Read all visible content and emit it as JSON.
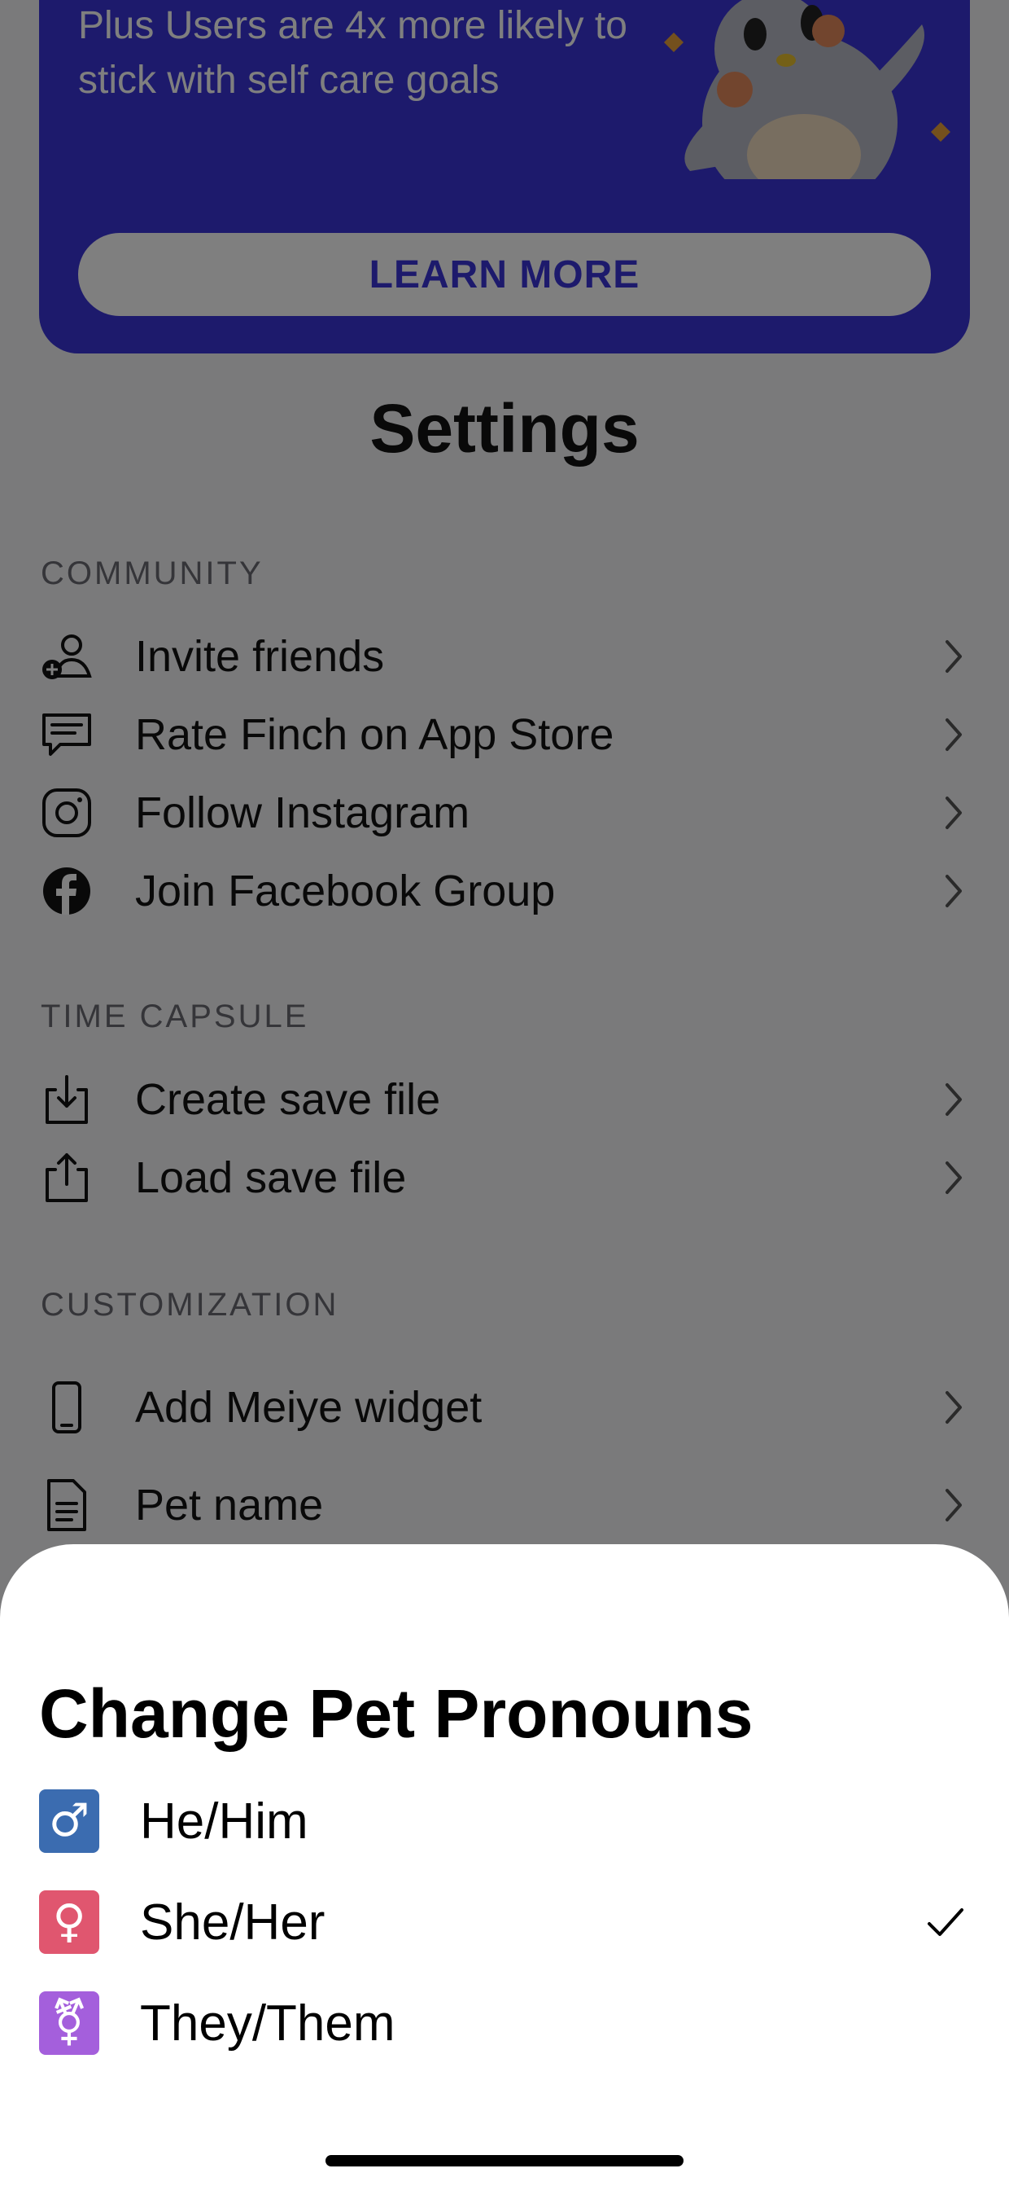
{
  "promo": {
    "text": "Plus Users are 4x more likely to stick with self care goals",
    "button_label": "LEARN MORE",
    "accent": "#3a34d8"
  },
  "settings_title": "Settings",
  "sections": {
    "community": {
      "header": "COMMUNITY",
      "items": [
        {
          "label": "Invite friends",
          "icon": "add-person-icon"
        },
        {
          "label": "Rate Finch on App Store",
          "icon": "chat-icon"
        },
        {
          "label": "Follow Instagram",
          "icon": "instagram-icon"
        },
        {
          "label": "Join Facebook Group",
          "icon": "facebook-icon"
        }
      ]
    },
    "time_capsule": {
      "header": "TIME CAPSULE",
      "items": [
        {
          "label": "Create save file",
          "icon": "download-icon"
        },
        {
          "label": "Load save file",
          "icon": "upload-icon"
        }
      ]
    },
    "customization": {
      "header": "CUSTOMIZATION",
      "items": [
        {
          "label": "Add Meiye widget",
          "icon": "phone-icon"
        },
        {
          "label": "Pet name",
          "icon": "document-icon"
        }
      ]
    }
  },
  "sheet": {
    "title": "Change Pet Pronouns",
    "options": [
      {
        "label": "He/Him",
        "symbol": "♂",
        "color": "#3b6cb0",
        "selected": false
      },
      {
        "label": "She/Her",
        "symbol": "♀",
        "color": "#e0566f",
        "selected": true
      },
      {
        "label": "They/Them",
        "symbol": "⚧",
        "color": "#a45fdc",
        "selected": false
      }
    ]
  }
}
